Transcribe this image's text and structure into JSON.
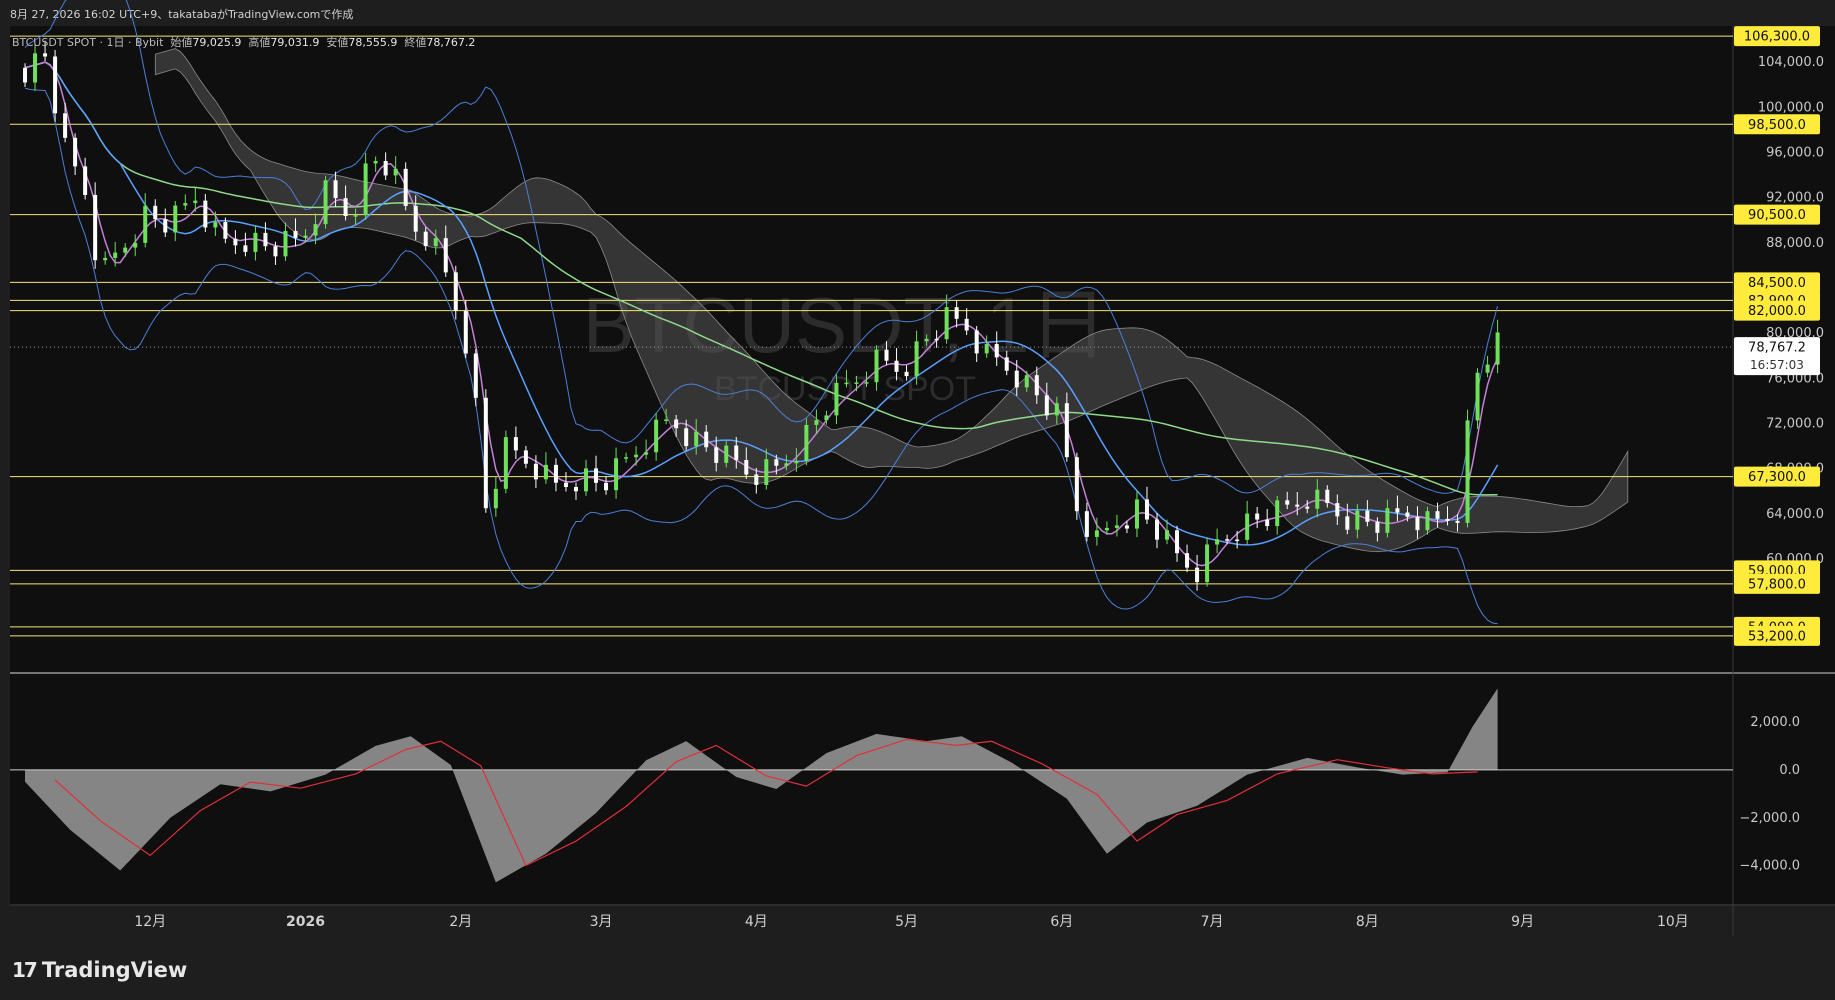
{
  "header": {
    "caption": "8月 27, 2026 16:02 UTC+9、takatabaがTradingView.comで作成"
  },
  "legend": {
    "symbol": "BTCUSDT SPOT · 1日 · Bybit",
    "open_label": "始値",
    "open_value": "79,025.9",
    "high_label": "高値",
    "high_value": "79,031.9",
    "low_label": "安値",
    "low_value": "78,555.9",
    "close_label": "終値",
    "close_value": "78,767.2"
  },
  "watermark": {
    "line1": "BTCUSDT, 1日",
    "line2": "BTCUSDT SPOT"
  },
  "footer": {
    "brand": "TradingView"
  },
  "colors": {
    "background": "#1e1e1e",
    "plot_bg": "#0f0f0f",
    "up_candle": "#6ee05a",
    "down_candle": "#ffffff",
    "level_line": "#f5e67a",
    "level_badge": "#ffeb3b",
    "bollinger": "#4a7fd6",
    "sma_short": "#c47fd8",
    "sma_mid": "#5aa0ff",
    "sma_long": "#8fd98a",
    "cloud": "#555555",
    "histogram": "#9a9a9a",
    "signal": "#e0303a"
  },
  "chart_data": [
    {
      "type": "candlestick",
      "title": "BTCUSDT SPOT · 1日 · Bybit",
      "y_axis": {
        "ticks": [
          {
            "value": 104000,
            "label": "104,000.0"
          },
          {
            "value": 100000,
            "label": "100,000.0"
          },
          {
            "value": 96000,
            "label": "96,000.0"
          },
          {
            "value": 92000,
            "label": "92,000.0"
          },
          {
            "value": 88000,
            "label": "88,000.0"
          },
          {
            "value": 80000,
            "label": "80,000.0"
          },
          {
            "value": 76000,
            "label": "76,000.0"
          },
          {
            "value": 72000,
            "label": "72,000.0"
          },
          {
            "value": 68000,
            "label": "68,000.0"
          },
          {
            "value": 64000,
            "label": "64,000.0"
          },
          {
            "value": 60000,
            "label": "60,000.0"
          }
        ]
      },
      "x_axis": {
        "ticks": [
          "12月",
          "2026",
          "2月",
          "3月",
          "4月",
          "5月",
          "6月",
          "7月",
          "8月",
          "9月",
          "10月"
        ]
      },
      "levels": [
        {
          "value": 106300,
          "label": "106,300.0"
        },
        {
          "value": 98500,
          "label": "98,500.0"
        },
        {
          "value": 90500,
          "label": "90,500.0"
        },
        {
          "value": 84500,
          "label": "84,500.0"
        },
        {
          "value": 82900,
          "label": "82,900.0"
        },
        {
          "value": 82000,
          "label": "82,000.0"
        },
        {
          "value": 67300,
          "label": "67,300.0"
        },
        {
          "value": 59000,
          "label": "59,000.0"
        },
        {
          "value": 57800,
          "label": "57,800.0"
        },
        {
          "value": 54000,
          "label": "54,000.0"
        },
        {
          "value": 53200,
          "label": "53,200.0"
        }
      ],
      "current_price": {
        "value": 78767.2,
        "label": "78,767.2",
        "countdown": "16:57:03"
      },
      "price_path": [
        {
          "date": "2025-11-06",
          "close": 103500
        },
        {
          "date": "2025-11-10",
          "close": 104500
        },
        {
          "date": "2025-11-14",
          "close": 96000
        },
        {
          "date": "2025-11-18",
          "close": 92500
        },
        {
          "date": "2025-11-21",
          "close": 85000
        },
        {
          "date": "2025-11-25",
          "close": 87500
        },
        {
          "date": "2025-11-30",
          "close": 90500
        },
        {
          "date": "2025-12-05",
          "close": 89500
        },
        {
          "date": "2025-12-10",
          "close": 92000
        },
        {
          "date": "2025-12-15",
          "close": 88000
        },
        {
          "date": "2025-12-20",
          "close": 88500
        },
        {
          "date": "2025-12-25",
          "close": 87500
        },
        {
          "date": "2025-12-31",
          "close": 88000
        },
        {
          "date": "2026-01-05",
          "close": 92500
        },
        {
          "date": "2026-01-10",
          "close": 90500
        },
        {
          "date": "2026-01-14",
          "close": 95500
        },
        {
          "date": "2026-01-18",
          "close": 94500
        },
        {
          "date": "2026-01-22",
          "close": 89500
        },
        {
          "date": "2026-01-26",
          "close": 88500
        },
        {
          "date": "2026-01-30",
          "close": 84000
        },
        {
          "date": "2026-02-03",
          "close": 78000
        },
        {
          "date": "2026-02-06",
          "close": 64500
        },
        {
          "date": "2026-02-10",
          "close": 69500
        },
        {
          "date": "2026-02-15",
          "close": 68500
        },
        {
          "date": "2026-02-20",
          "close": 66500
        },
        {
          "date": "2026-02-25",
          "close": 67500
        },
        {
          "date": "2026-03-01",
          "close": 66500
        },
        {
          "date": "2026-03-05",
          "close": 68000
        },
        {
          "date": "2026-03-10",
          "close": 70500
        },
        {
          "date": "2026-03-15",
          "close": 72500
        },
        {
          "date": "2026-03-20",
          "close": 70500
        },
        {
          "date": "2026-03-25",
          "close": 69000
        },
        {
          "date": "2026-03-31",
          "close": 67500
        },
        {
          "date": "2026-04-05",
          "close": 68000
        },
        {
          "date": "2026-04-10",
          "close": 70500
        },
        {
          "date": "2026-04-15",
          "close": 73500
        },
        {
          "date": "2026-04-20",
          "close": 75500
        },
        {
          "date": "2026-04-25",
          "close": 77500
        },
        {
          "date": "2026-04-30",
          "close": 77000
        },
        {
          "date": "2026-05-05",
          "close": 79500
        },
        {
          "date": "2026-05-09",
          "close": 81000
        },
        {
          "date": "2026-05-13",
          "close": 80500
        },
        {
          "date": "2026-05-17",
          "close": 78000
        },
        {
          "date": "2026-05-22",
          "close": 77000
        },
        {
          "date": "2026-05-27",
          "close": 74500
        },
        {
          "date": "2026-05-31",
          "close": 72500
        },
        {
          "date": "2026-06-04",
          "close": 64500
        },
        {
          "date": "2026-06-08",
          "close": 61500
        },
        {
          "date": "2026-06-12",
          "close": 63500
        },
        {
          "date": "2026-06-16",
          "close": 64500
        },
        {
          "date": "2026-06-20",
          "close": 62500
        },
        {
          "date": "2026-06-24",
          "close": 60000
        },
        {
          "date": "2026-06-28",
          "close": 59000
        },
        {
          "date": "2026-07-02",
          "close": 61500
        },
        {
          "date": "2026-07-06",
          "close": 63000
        },
        {
          "date": "2026-07-10",
          "close": 63500
        },
        {
          "date": "2026-07-15",
          "close": 64000
        },
        {
          "date": "2026-07-20",
          "close": 65500
        },
        {
          "date": "2026-07-25",
          "close": 64500
        },
        {
          "date": "2026-07-30",
          "close": 63500
        },
        {
          "date": "2026-08-04",
          "close": 63000
        },
        {
          "date": "2026-08-09",
          "close": 64000
        },
        {
          "date": "2026-08-14",
          "close": 63000
        },
        {
          "date": "2026-08-19",
          "close": 64500
        },
        {
          "date": "2026-08-21",
          "close": 71500
        },
        {
          "date": "2026-08-23",
          "close": 76500
        },
        {
          "date": "2026-08-25",
          "close": 78000
        },
        {
          "date": "2026-08-27",
          "close": 78767
        }
      ]
    },
    {
      "type": "area",
      "title": "",
      "y_axis": {
        "ticks": [
          {
            "value": 2000,
            "label": "2,000.0"
          },
          {
            "value": 0,
            "label": "0.0"
          },
          {
            "value": -2000,
            "label": "−2,000.0"
          },
          {
            "value": -4000,
            "label": "−4,000.0"
          }
        ]
      },
      "series": [
        {
          "values": [
            {
              "date": "2025-11-06",
              "v": -500
            },
            {
              "date": "2025-11-15",
              "v": -2500
            },
            {
              "date": "2025-11-25",
              "v": -4200
            },
            {
              "date": "2025-12-05",
              "v": -2000
            },
            {
              "date": "2025-12-15",
              "v": -600
            },
            {
              "date": "2025-12-25",
              "v": -900
            },
            {
              "date": "2026-01-05",
              "v": -200
            },
            {
              "date": "2026-01-15",
              "v": 1000
            },
            {
              "date": "2026-01-22",
              "v": 1400
            },
            {
              "date": "2026-01-30",
              "v": 200
            },
            {
              "date": "2026-02-08",
              "v": -4700
            },
            {
              "date": "2026-02-18",
              "v": -3500
            },
            {
              "date": "2026-02-28",
              "v": -1800
            },
            {
              "date": "2026-03-10",
              "v": 400
            },
            {
              "date": "2026-03-18",
              "v": 1200
            },
            {
              "date": "2026-03-28",
              "v": -300
            },
            {
              "date": "2026-04-05",
              "v": -800
            },
            {
              "date": "2026-04-15",
              "v": 700
            },
            {
              "date": "2026-04-25",
              "v": 1500
            },
            {
              "date": "2026-05-05",
              "v": 1200
            },
            {
              "date": "2026-05-12",
              "v": 1400
            },
            {
              "date": "2026-05-22",
              "v": 300
            },
            {
              "date": "2026-06-02",
              "v": -1200
            },
            {
              "date": "2026-06-10",
              "v": -3500
            },
            {
              "date": "2026-06-18",
              "v": -2200
            },
            {
              "date": "2026-06-28",
              "v": -1500
            },
            {
              "date": "2026-07-08",
              "v": -200
            },
            {
              "date": "2026-07-20",
              "v": 500
            },
            {
              "date": "2026-07-30",
              "v": 100
            },
            {
              "date": "2026-08-08",
              "v": -200
            },
            {
              "date": "2026-08-17",
              "v": -100
            },
            {
              "date": "2026-08-22",
              "v": 1800
            },
            {
              "date": "2026-08-27",
              "v": 3400
            }
          ]
        }
      ]
    }
  ]
}
